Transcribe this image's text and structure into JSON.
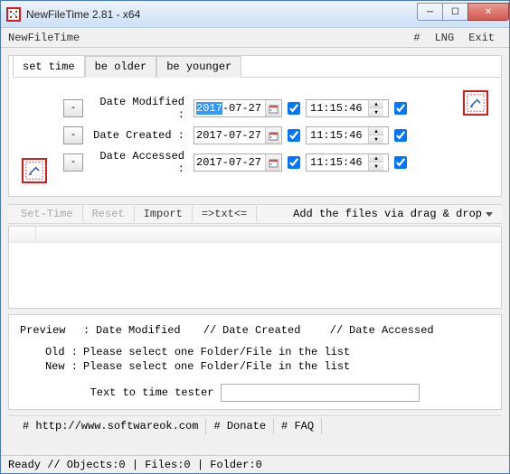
{
  "window": {
    "title": "NewFileTime 2.81 - x64"
  },
  "menubar": {
    "app_name": "NewFileTime",
    "hash": "#",
    "lng": "LNG",
    "exit": "Exit"
  },
  "tabs": {
    "set_time": "set time",
    "be_older": "be older",
    "be_younger": "be younger"
  },
  "rows": {
    "modified": {
      "label": "Date Modified :",
      "date_sel": "2017",
      "date_rest": "-07-27",
      "time": "11:15:46",
      "check_date": true,
      "check_time": true
    },
    "created": {
      "label": "Date Created :",
      "date": "2017-07-27",
      "time": "11:15:46",
      "check_date": true,
      "check_time": true
    },
    "accessed": {
      "label": "Date Accessed :",
      "date": "2017-07-27",
      "time": "11:15:46",
      "check_date": true,
      "check_time": true
    },
    "minus": "-"
  },
  "toolbar": {
    "set_time": "Set-Time",
    "reset": "Reset",
    "import": "Import",
    "txt": "=>txt<=",
    "drag_drop": "Add the files via drag & drop"
  },
  "preview": {
    "header_preview": "Preview",
    "header_modified": "Date Modified",
    "header_created": "Date Created",
    "header_accessed": "Date Accessed",
    "sep": "//",
    "colon": ":",
    "old_label": "Old :",
    "new_label": "New :",
    "msg": "Please select one Folder/File in the list"
  },
  "tester": {
    "label": "Text to time tester",
    "value": ""
  },
  "bottom": {
    "url": "# http://www.softwareok.com",
    "donate": "# Donate",
    "faq": "# FAQ"
  },
  "status": {
    "text": "Ready // Objects:0 | Files:0 | Folder:0"
  }
}
